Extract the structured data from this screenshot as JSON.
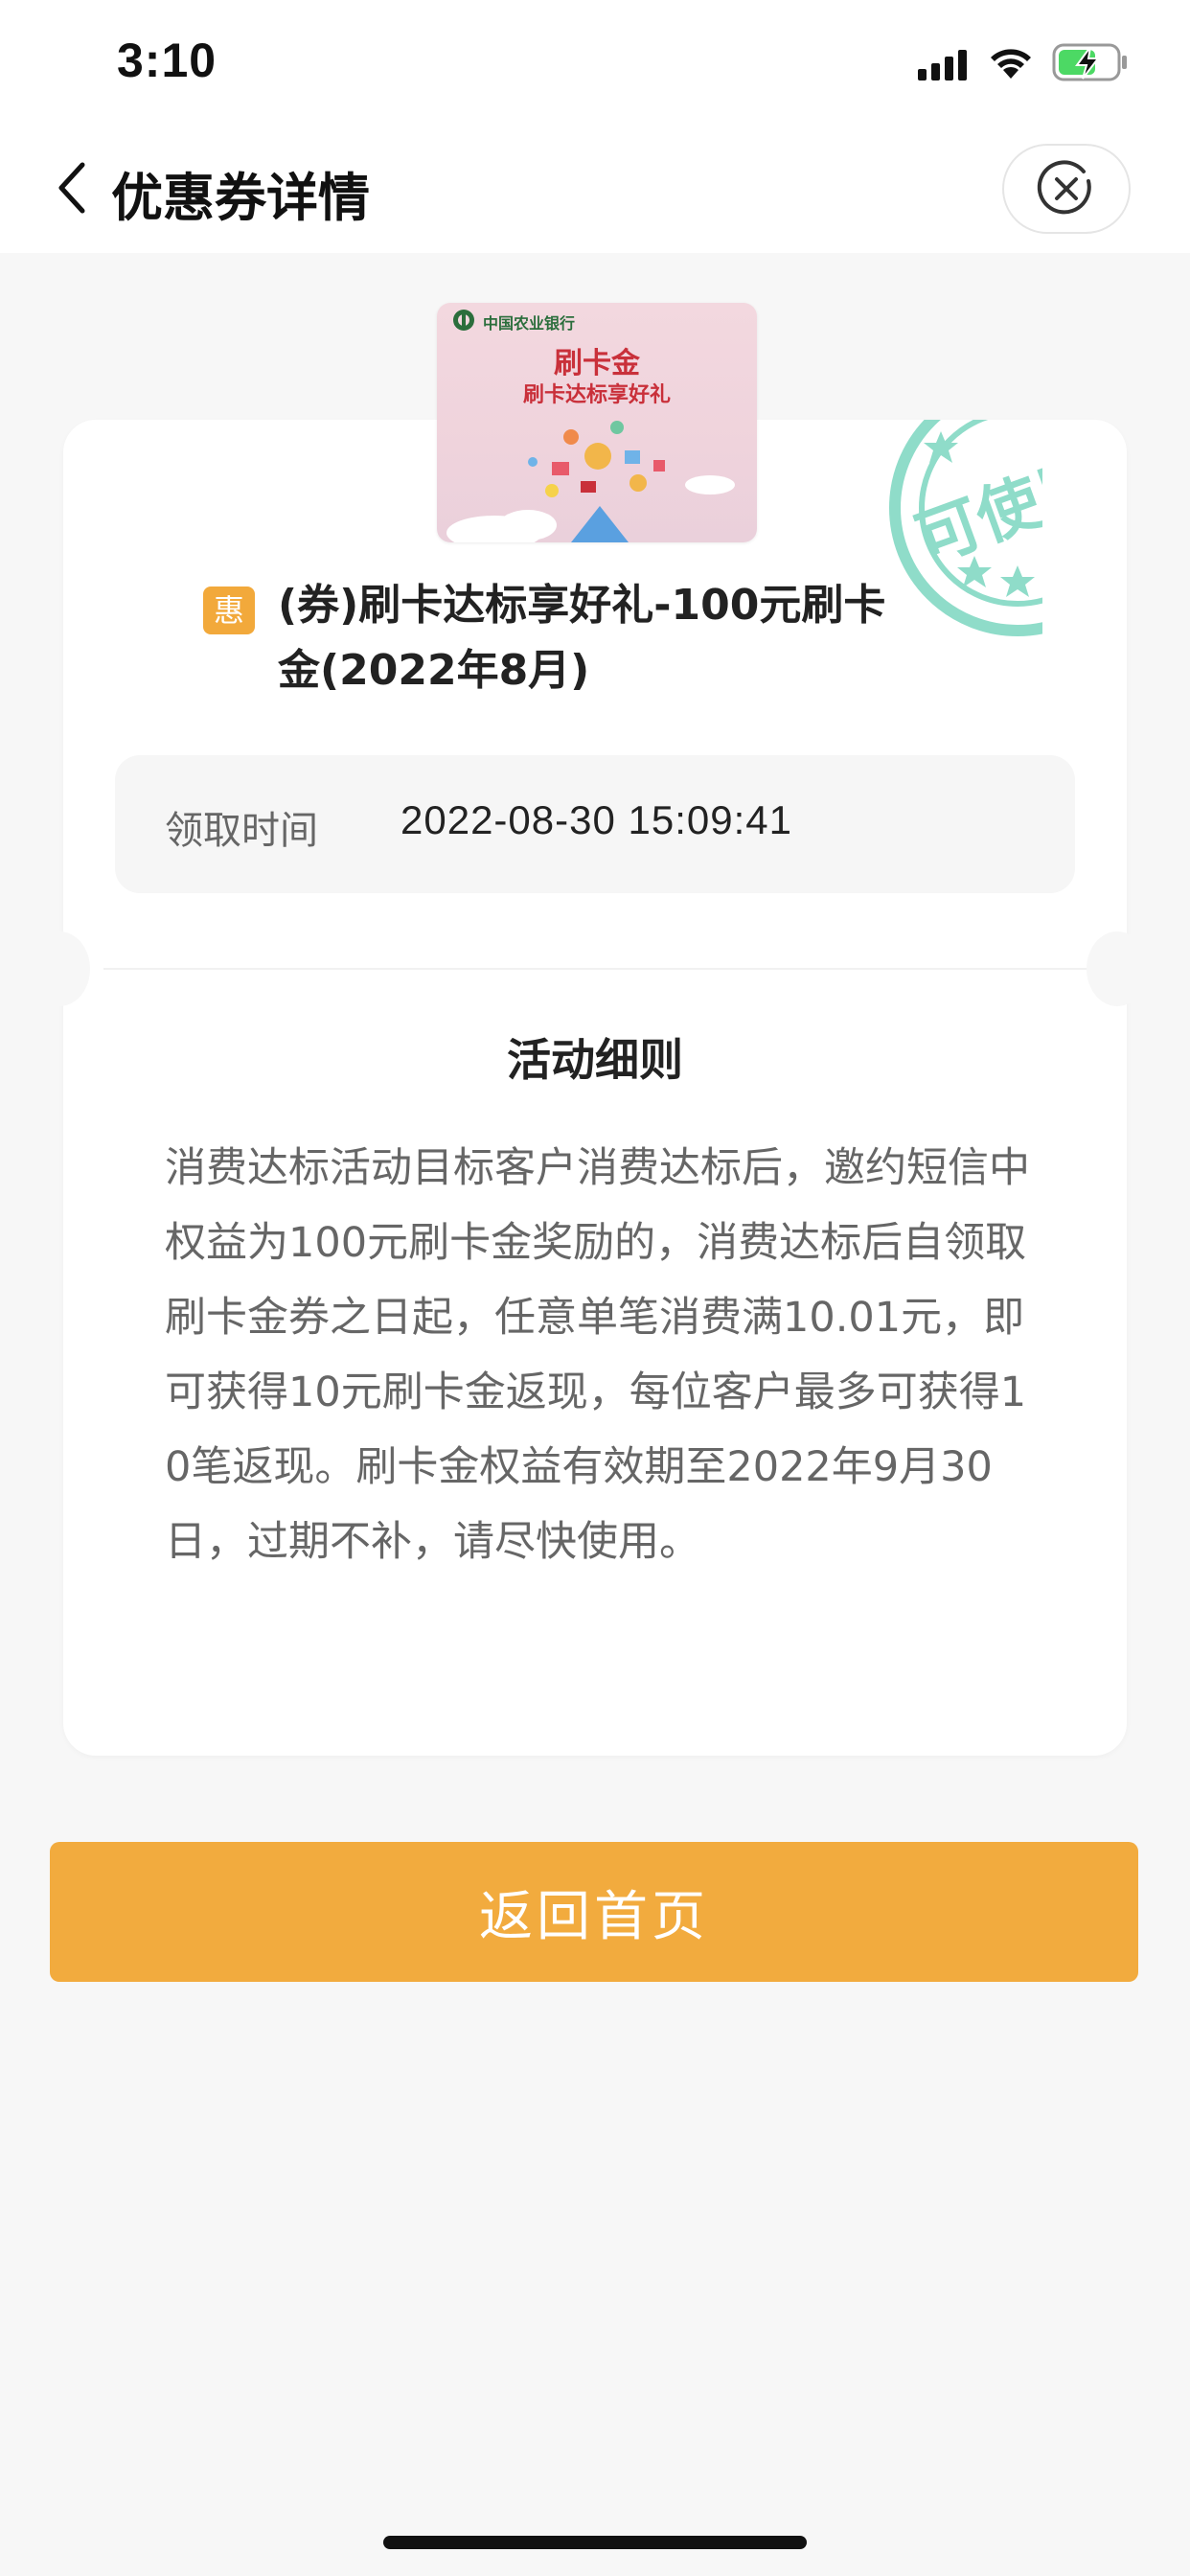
{
  "status_bar": {
    "time": "3:10",
    "icons": [
      "signal-icon",
      "wifi-icon",
      "battery-charging-icon"
    ]
  },
  "nav": {
    "title": "优惠券详情",
    "back_icon": "chevron-left-icon",
    "close_icon": "close-circle-icon"
  },
  "coupon": {
    "image": {
      "bank_name": "中国农业银行",
      "title": "刷卡金",
      "subtitle": "刷卡达标享好礼"
    },
    "stamp_text": "可使用",
    "badge": "惠",
    "title": "(券)刷卡达标享好礼-100元刷卡金(2022年8月)",
    "claim_label": "领取时间",
    "claim_time": "2022-08-30 15:09:41"
  },
  "rules": {
    "heading": "活动细则",
    "body": "消费达标活动目标客户消费达标后，邀约短信中权益为100元刷卡金奖励的，消费达标后自领取刷卡金券之日起，任意单笔消费满10.01元，即可获得10元刷卡金返现，每位客户最多可获得10笔返现。刷卡金权益有效期至2022年9月30日，过期不补，请尽快使用。"
  },
  "actions": {
    "home_button": "返回首页"
  },
  "colors": {
    "accent": "#f2ab3e",
    "stamp": "#8fdcc9",
    "background": "#f7f7f7"
  }
}
